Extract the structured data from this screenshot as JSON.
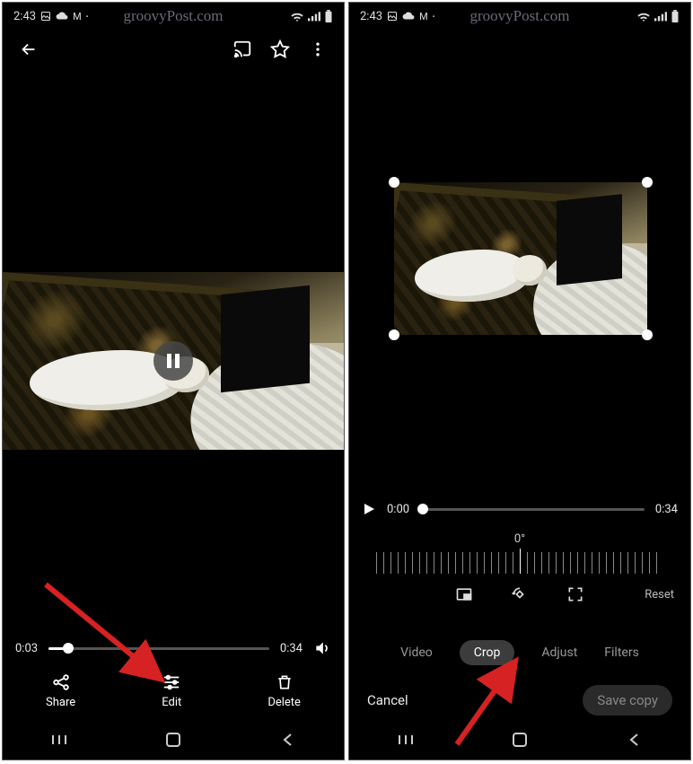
{
  "status": {
    "time": "2:43",
    "watermark": "groovyPost.com"
  },
  "left": {
    "playback": {
      "current": "0:03",
      "total": "0:34"
    },
    "actions": {
      "share": "Share",
      "edit": "Edit",
      "delete": "Delete"
    }
  },
  "right": {
    "playback": {
      "current": "0:00",
      "total": "0:34"
    },
    "degree": "0°",
    "reset": "Reset",
    "tabs": {
      "video": "Video",
      "crop": "Crop",
      "adjust": "Adjust",
      "filters": "Filters"
    },
    "footer": {
      "cancel": "Cancel",
      "save": "Save copy"
    }
  }
}
